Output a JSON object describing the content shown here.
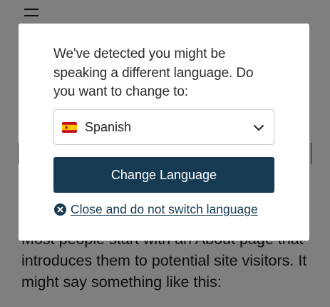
{
  "background": {
    "paragraph": "Most people start with an About page that introduces them to potential site visitors. It might say something like this:"
  },
  "modal": {
    "message": "We've detected you might be speaking a different language. Do you want to change to:",
    "language_select": {
      "selected": "Spanish",
      "flag_icon": "spain-flag-icon"
    },
    "change_button_label": "Change Language",
    "close_link_label": "Close and do not switch language",
    "colors": {
      "primary": "#163a52",
      "overlay": "rgba(0,0,0,0.5)"
    }
  }
}
